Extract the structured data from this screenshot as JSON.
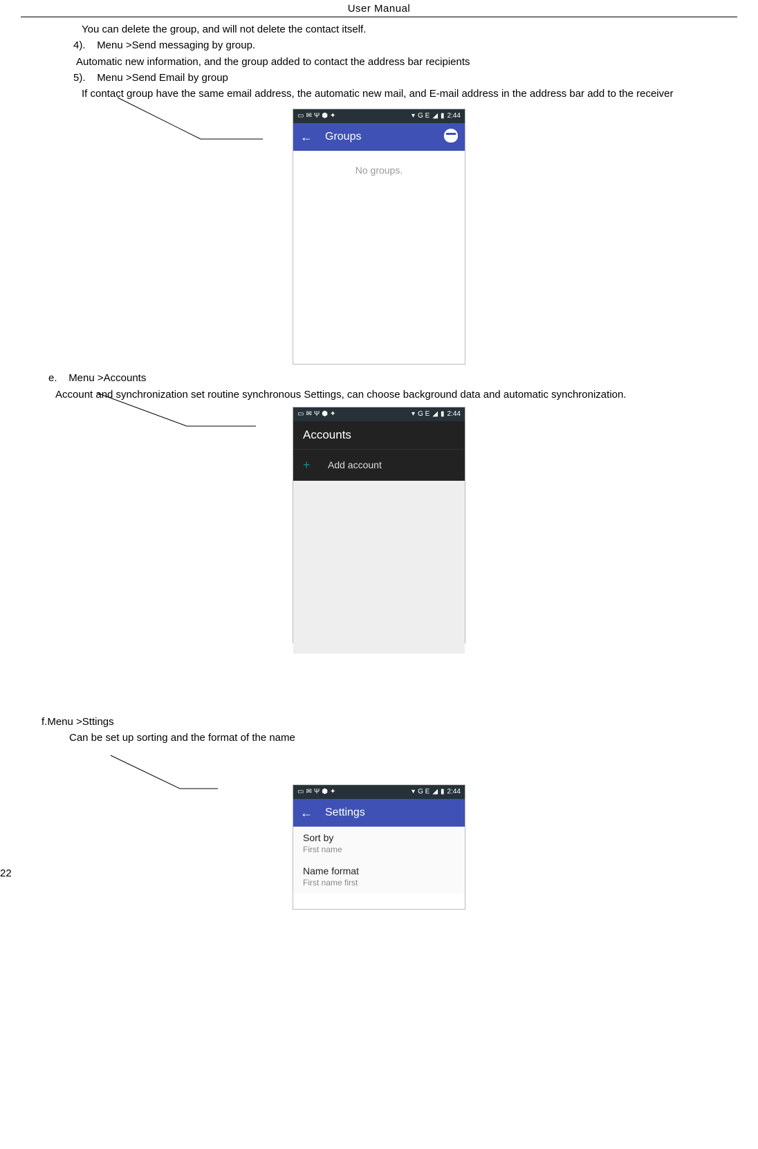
{
  "header": "User    Manual",
  "p_delete": "You can delete the group, and will not delete the contact itself.",
  "n4": "4).",
  "t4": "Menu >Send messaging by group.",
  "p4": "Automatic new information, and the group added to contact the address bar recipients",
  "n5": "5).",
  "t5": "Menu >Send Email by group",
  "p5": "If contact group have the same email address, the automatic new mail, and E-mail address in the address bar add to the receiver",
  "ne": "e.",
  "te": "Menu >Accounts",
  "pe": "Account and synchronization set routine synchronous Settings, can choose background data and automatic synchronization.",
  "nf": "f.",
  "tf": "Menu >Sttings",
  "pf": "Can be set up sorting and the format of the name",
  "status": {
    "time": "2:44",
    "signal_label": "G  E",
    "wifi": "▾",
    "batt": "▮"
  },
  "screen_groups": {
    "title": "Groups",
    "empty": "No groups."
  },
  "screen_accounts": {
    "title": "Accounts",
    "add": "Add account"
  },
  "screen_settings": {
    "title": "Settings",
    "sortby_title": "Sort by",
    "sortby_sub": "First name",
    "nameformat_title": "Name format",
    "nameformat_sub": "First name first"
  },
  "page_number": "22"
}
